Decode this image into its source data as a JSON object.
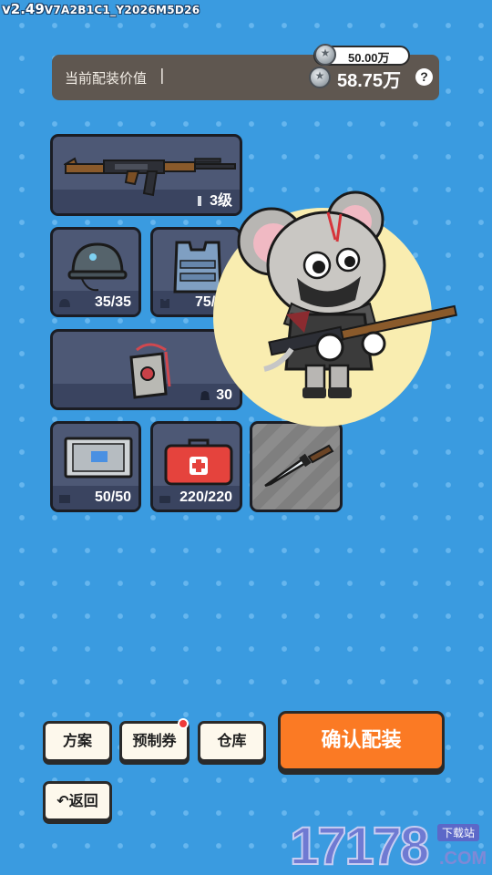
{
  "version": {
    "main": "v2.49",
    "build": "V7A2B1C1_Y2026M5D26"
  },
  "value_bar": {
    "label": "当前配装价值",
    "cursor": "|",
    "budget": "50.00万",
    "current": "58.75万",
    "help": "?"
  },
  "slots": {
    "weapon": {
      "level": "3级"
    },
    "helmet": {
      "durability": "35/35"
    },
    "armor": {
      "durability": "75/75"
    },
    "backpack": {
      "capacity": "30"
    },
    "armor_plate": {
      "count": "50/50"
    },
    "medkit": {
      "count": "220/220"
    }
  },
  "buttons": {
    "plan": "方案",
    "voucher": "预制券",
    "warehouse": "仓库",
    "confirm": "确认配装",
    "back": "返回",
    "back_icon": "↶"
  },
  "watermark": {
    "number": "17178",
    "tag": "下载站",
    "domain": ".COM"
  },
  "colors": {
    "background": "#3a9be0",
    "confirm": "#fb7a24",
    "slot": "#4d5875",
    "value_bar": "#5f5750"
  }
}
